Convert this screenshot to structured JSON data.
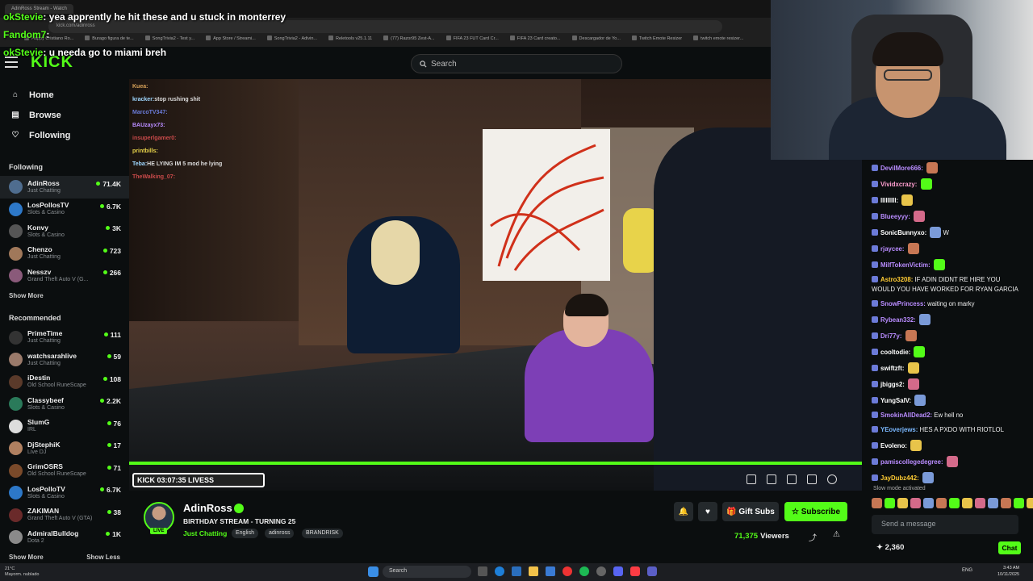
{
  "browser": {
    "tab_title": "AdinRoss Stream - Watch",
    "url": "kick.com/adinross",
    "bookmarks": [
      "Happy Cristiano Ro...",
      "Burago figura de te...",
      "SongTrivia2 - Test y...",
      "App Store / Streami...",
      "SongTrivia2 - Adivin...",
      "Reletools v25.1.11",
      "(77) Razor95 Zest-A...",
      "FIFA 23 FUT Card Cr...",
      "FIFA 23 Card creato...",
      "Descargador de Yo...",
      "Twitch Emote Resizer",
      "twitch emote resizer..."
    ]
  },
  "overlay_chat": [
    {
      "user": "okStevie",
      "text": ": yea apprently he hit these and u stuck in monterrey"
    },
    {
      "user": "Fandom7",
      "text": ":"
    },
    {
      "user": "okStevie",
      "text": ": u needa go to miami breh"
    }
  ],
  "header": {
    "logo": "KICK",
    "search_placeholder": "Search"
  },
  "sidebar": {
    "nav": [
      {
        "label": "Home",
        "icon": "home-icon",
        "glyph": "⌂"
      },
      {
        "label": "Browse",
        "icon": "browse-icon",
        "glyph": "▤"
      },
      {
        "label": "Following",
        "icon": "heart-icon",
        "glyph": "♡"
      }
    ],
    "following_title": "Following",
    "following": [
      {
        "name": "AdinRoss",
        "category": "Just Chatting",
        "viewers": "71.4K",
        "color": "#4f6d8f"
      },
      {
        "name": "LosPollosTV",
        "category": "Slots & Casino",
        "viewers": "6.7K",
        "color": "#2d78c8"
      },
      {
        "name": "Konvy",
        "category": "Slots & Casino",
        "viewers": "3K",
        "color": "#555"
      },
      {
        "name": "Chenzo",
        "category": "Just Chatting",
        "viewers": "723",
        "color": "#a0785a"
      },
      {
        "name": "Nesszv",
        "category": "Grand Theft Auto V (G...",
        "viewers": "266",
        "color": "#8a5a7a"
      }
    ],
    "show_more": "Show More",
    "recommended_title": "Recommended",
    "recommended": [
      {
        "name": "PrimeTime",
        "category": "Just Chatting",
        "viewers": "111",
        "color": "#333"
      },
      {
        "name": "watchsarahlive",
        "category": "Just Chatting",
        "viewers": "59",
        "color": "#9a7a6a"
      },
      {
        "name": "iDestin",
        "category": "Old School RuneScape",
        "viewers": "108",
        "color": "#5a3a2a"
      },
      {
        "name": "Classybeef",
        "category": "Slots & Casino",
        "viewers": "2.2K",
        "color": "#2a7a5a"
      },
      {
        "name": "SlumG",
        "category": "IRL",
        "viewers": "76",
        "color": "#ddd"
      },
      {
        "name": "DjStephiK",
        "category": "Live DJ",
        "viewers": "17",
        "color": "#b08060"
      },
      {
        "name": "GrimOSRS",
        "category": "Old School RuneScape",
        "viewers": "71",
        "color": "#7a4a2a"
      },
      {
        "name": "LosPolloTV",
        "category": "Slots & Casino",
        "viewers": "6.7K",
        "color": "#2d78c8"
      },
      {
        "name": "ZAKIMAN",
        "category": "Grand Theft Auto V (GTA)",
        "viewers": "38",
        "color": "#6a2a2a"
      },
      {
        "name": "AdmiralBulldog",
        "category": "Dota 2",
        "viewers": "1K",
        "color": "#8a8a8a"
      }
    ],
    "footer": {
      "show_more": "Show More",
      "show_less": "Show Less"
    }
  },
  "video": {
    "overlay_chat": [
      {
        "user": "Kuea:",
        "text": ""
      },
      {
        "user": "kracker:",
        "text": "stop rushing shit"
      },
      {
        "user": "MarcoTV347:",
        "text": ""
      },
      {
        "user": "BAUzayx73:",
        "text": ""
      },
      {
        "user": "insuperlgamer0:",
        "text": ""
      },
      {
        "user": "",
        "text": ""
      },
      {
        "user": "printbills:",
        "text": ""
      },
      {
        "user": "Teba:",
        "text": "HE LYING IM 5 mod he lying"
      },
      {
        "user": "",
        "text": ""
      },
      {
        "user": "TheWalking_07:",
        "text": ""
      }
    ],
    "timestamp_badge": "KICK  03:07:35  LIVESS",
    "progress": 1.0
  },
  "stream_info": {
    "streamer": "AdinRoss",
    "title": "BIRTHDAY STREAM - TURNING 25",
    "category": "Just Chatting",
    "tags": [
      "English",
      "adinross",
      "BRANDRISK"
    ],
    "live": "LIVE",
    "gift_subs": "Gift Subs",
    "subscribe": "Subscribe",
    "viewer_count": "71,375",
    "viewers_label": "Viewers"
  },
  "chat": {
    "messages": [
      {
        "user": "DevilMore666:",
        "text": "",
        "color": "#b98cff",
        "emote": true
      },
      {
        "user": "Vividxcrazy:",
        "text": "",
        "color": "#ff9ecf",
        "emote": true
      },
      {
        "user": "IIIIIIIII:",
        "text": "",
        "color": "#ffffff",
        "emote": true
      },
      {
        "user": "Blueeyyy:",
        "text": "",
        "color": "#b98cff",
        "emote": true
      },
      {
        "user": "SonicBunnyxo:",
        "text": "W",
        "color": "#ffffff",
        "emote": true
      },
      {
        "user": "rjaycee:",
        "text": "",
        "color": "#b98cff",
        "emote": true
      },
      {
        "user": "MilfTokenVictim:",
        "text": "",
        "color": "#b98cff",
        "emote": true
      },
      {
        "user": "Astro3208:",
        "text": "IF ADIN DIDNT RE HIRE YOU WOULD YOU HAVE WORKED FOR RYAN GARCIA",
        "color": "#ffcc33",
        "emote": false
      },
      {
        "user": "SnowPrincess:",
        "text": "waiting on marky",
        "color": "#b98cff",
        "emote": false
      },
      {
        "user": "Rybean332:",
        "text": "",
        "color": "#b98cff",
        "emote": true
      },
      {
        "user": "Dri77y:",
        "text": "",
        "color": "#b98cff",
        "emote": true
      },
      {
        "user": "cooltodie:",
        "text": "",
        "color": "#ffffff",
        "emote": true
      },
      {
        "user": "swiftzft:",
        "text": "",
        "color": "#ffffff",
        "emote": true
      },
      {
        "user": "jbiggs2:",
        "text": "",
        "color": "#ffffff",
        "emote": true
      },
      {
        "user": "YungSalV:",
        "text": "",
        "color": "#ffffff",
        "emote": true
      },
      {
        "user": "SmokinAllDead2:",
        "text": "Ew hell no",
        "color": "#b98cff",
        "emote": false
      },
      {
        "user": "YEoverjews:",
        "text": "HES A PXDO WITH RIOTLOL",
        "color": "#7ab8ff",
        "emote": false
      },
      {
        "user": "Evoleno:",
        "text": "",
        "color": "#ffffff",
        "emote": true
      },
      {
        "user": "pamiscollegedegree:",
        "text": "",
        "color": "#b98cff",
        "emote": true
      },
      {
        "user": "JayDubz442:",
        "text": "",
        "color": "#ffcc33",
        "emote": true
      }
    ],
    "slow_mode": "Slow mode activated",
    "input_placeholder": "Send a message",
    "points": "2,360",
    "chat_button": "Chat"
  },
  "taskbar": {
    "weather_temp": "21°C",
    "weather_desc": "Mayorm. nublado",
    "search": "Search",
    "lang": "ENG",
    "time": "3:43 AM",
    "date": "10/11/2025"
  },
  "colors": {
    "accent": "#53fc18",
    "bg": "#0b0e0f"
  }
}
